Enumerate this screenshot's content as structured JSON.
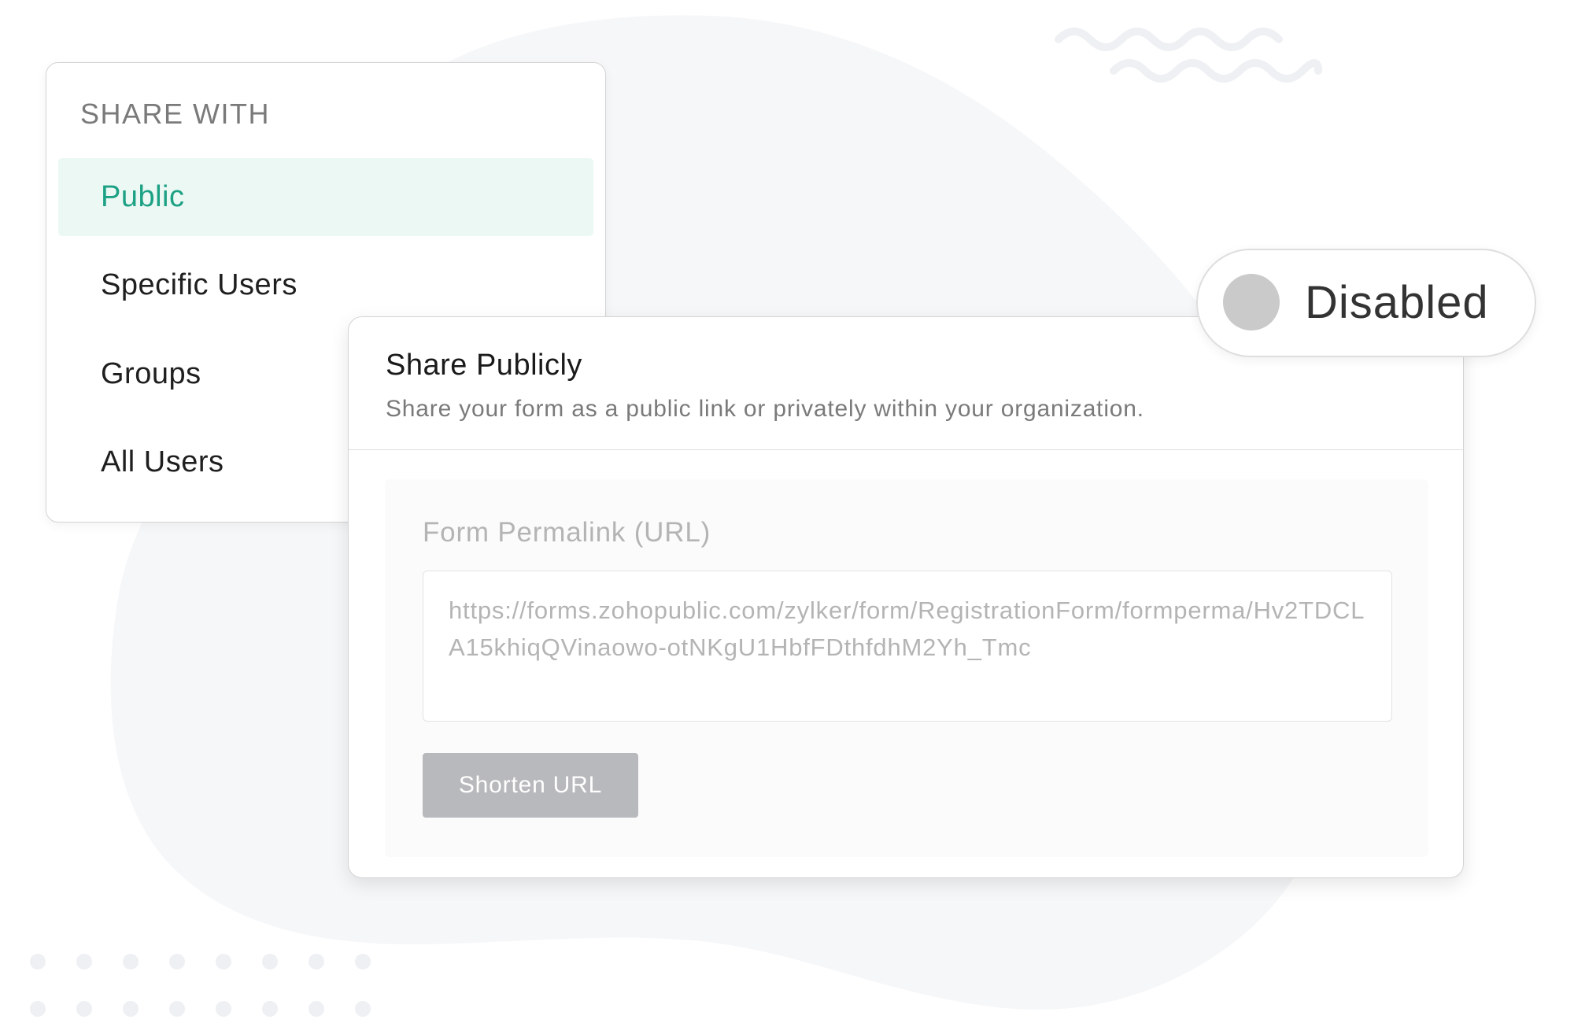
{
  "share_with": {
    "title": "SHARE WITH",
    "selected": "Public",
    "options": [
      {
        "label": "Public"
      },
      {
        "label": "Specific Users"
      },
      {
        "label": "Groups"
      },
      {
        "label": "All Users"
      }
    ]
  },
  "share_publicly": {
    "title": "Share Publicly",
    "description": "Share your form as a public link or privately within your organization.",
    "permalink_label": "Form Permalink (URL)",
    "permalink_value": "https://forms.zohopublic.com/zylker/form/RegistrationForm/formperma/Hv2TDCLA15khiqQVinaowo-otNKgU1HbfFDthfdhM2Yh_Tmc",
    "shorten_button_label": "Shorten URL"
  },
  "toggle": {
    "label": "Disabled",
    "state": "off"
  },
  "colors": {
    "accent": "#1ca184",
    "active_bg": "#ecf8f4",
    "button_disabled": "#b8b9bc",
    "knob_off": "#cacaca",
    "background_blob": "#f6f7f9"
  }
}
